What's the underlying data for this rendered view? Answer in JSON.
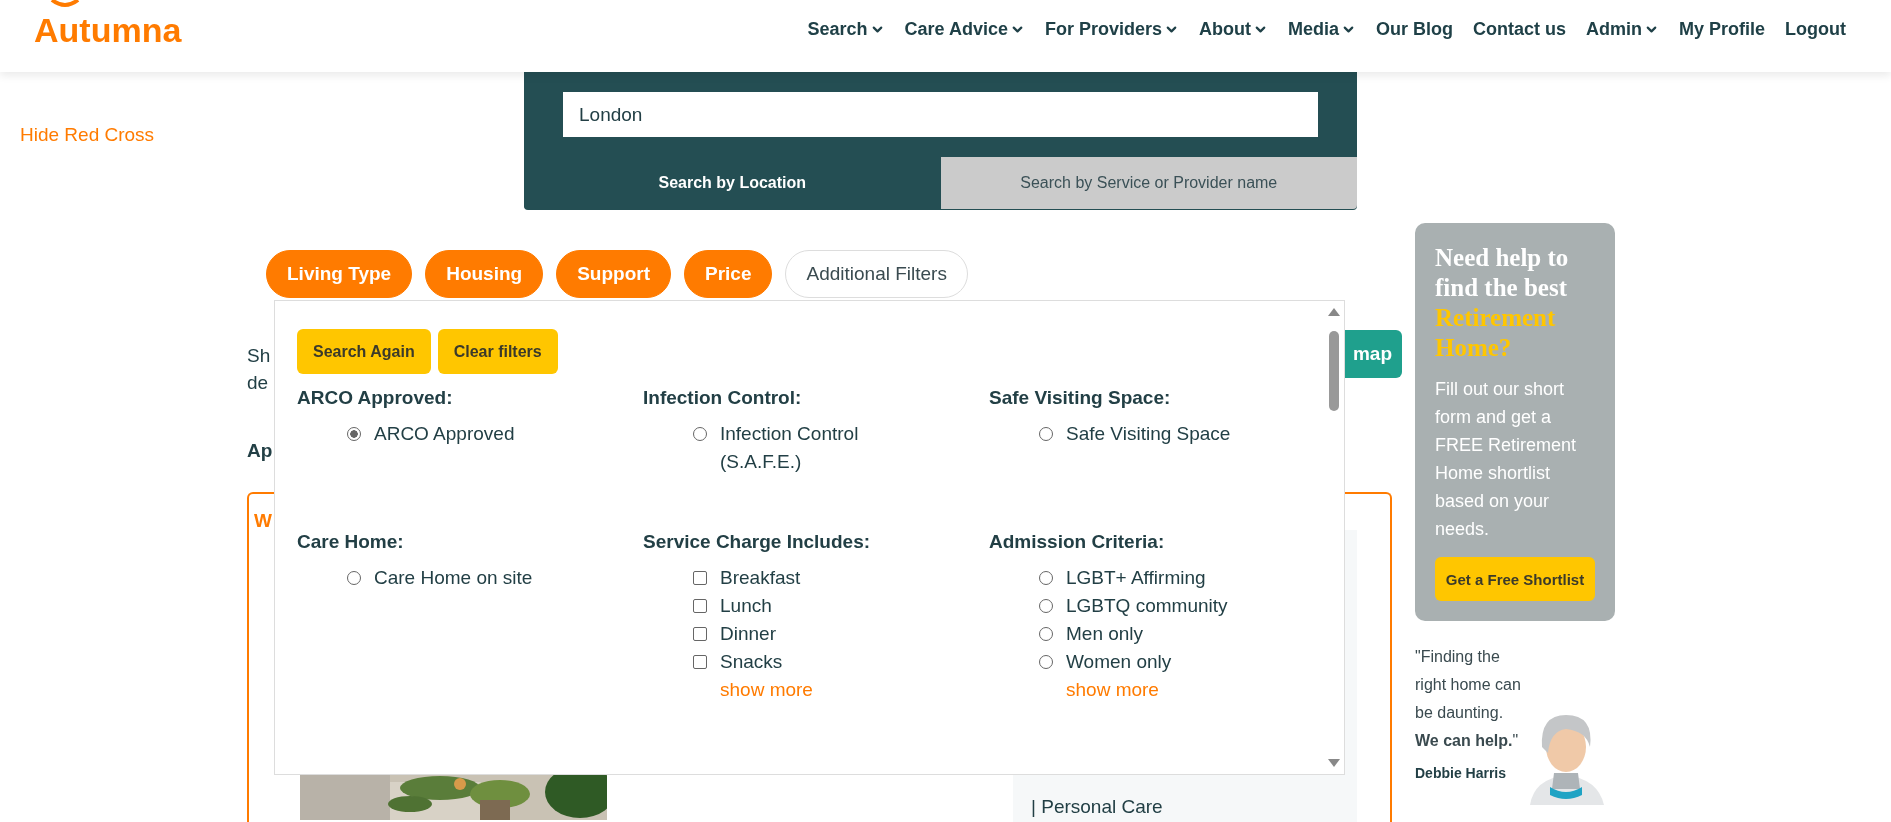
{
  "logo": {
    "text": "Autumna"
  },
  "nav": [
    {
      "label": "Search",
      "dropdown": true
    },
    {
      "label": "Care Advice",
      "dropdown": true
    },
    {
      "label": "For Providers",
      "dropdown": true
    },
    {
      "label": "About",
      "dropdown": true
    },
    {
      "label": "Media",
      "dropdown": true
    },
    {
      "label": "Our Blog",
      "dropdown": false
    },
    {
      "label": "Contact us",
      "dropdown": false
    },
    {
      "label": "Admin",
      "dropdown": true
    },
    {
      "label": "My Profile",
      "dropdown": false
    },
    {
      "label": "Logout",
      "dropdown": false
    }
  ],
  "hide_link": "Hide Red Cross",
  "search": {
    "value": "London",
    "tabs": [
      {
        "label": "Search by Location",
        "selected": true
      },
      {
        "label": "Search by Service or Provider name",
        "selected": false
      }
    ]
  },
  "filter_pills": [
    {
      "label": "Living Type",
      "active": true
    },
    {
      "label": "Housing",
      "active": true
    },
    {
      "label": "Support",
      "active": true
    },
    {
      "label": "Price",
      "active": true
    },
    {
      "label": "Additional Filters",
      "active": false
    }
  ],
  "background": {
    "intro_lines": [
      "Sh",
      "de"
    ],
    "heading": "Ap",
    "card_letter": "W",
    "map_button": "map",
    "services": "| Personal Care"
  },
  "filters_panel": {
    "actions": [
      "Search Again",
      "Clear filters"
    ],
    "groups": [
      {
        "title": "ARCO Approved:",
        "kind": "radio",
        "options": [
          {
            "label": "ARCO Approved",
            "checked": true
          }
        ]
      },
      {
        "title": "Infection Control:",
        "kind": "radio",
        "options": [
          {
            "label": "Infection Control (S.A.F.E.)",
            "checked": false
          }
        ]
      },
      {
        "title": "Safe Visiting Space:",
        "kind": "radio",
        "options": [
          {
            "label": "Safe Visiting Space",
            "checked": false
          }
        ]
      },
      {
        "title": "Care Home:",
        "kind": "radio",
        "options": [
          {
            "label": "Care Home on site",
            "checked": false
          }
        ]
      },
      {
        "title": "Service Charge Includes:",
        "kind": "checkbox",
        "options": [
          {
            "label": "Breakfast",
            "checked": false
          },
          {
            "label": "Lunch",
            "checked": false
          },
          {
            "label": "Dinner",
            "checked": false
          },
          {
            "label": "Snacks",
            "checked": false
          }
        ],
        "show_more": "show more"
      },
      {
        "title": "Admission Criteria:",
        "kind": "radio",
        "options": [
          {
            "label": "LGBT+ Affirming",
            "checked": false
          },
          {
            "label": "LGBTQ community",
            "checked": false
          },
          {
            "label": "Men only",
            "checked": false
          },
          {
            "label": "Women only",
            "checked": false
          }
        ],
        "show_more": "show more"
      }
    ]
  },
  "help_card": {
    "title": "Need help to find the best",
    "title_highlight": "Retirement Home?",
    "body": "Fill out our short form and get a FREE Retirement Home shortlist based on your needs.",
    "button": "Get a Free Shortlist"
  },
  "quote": {
    "text": "\"Finding the right home can be daunting. **We can help.**\"",
    "author": "Debbie Harris"
  }
}
